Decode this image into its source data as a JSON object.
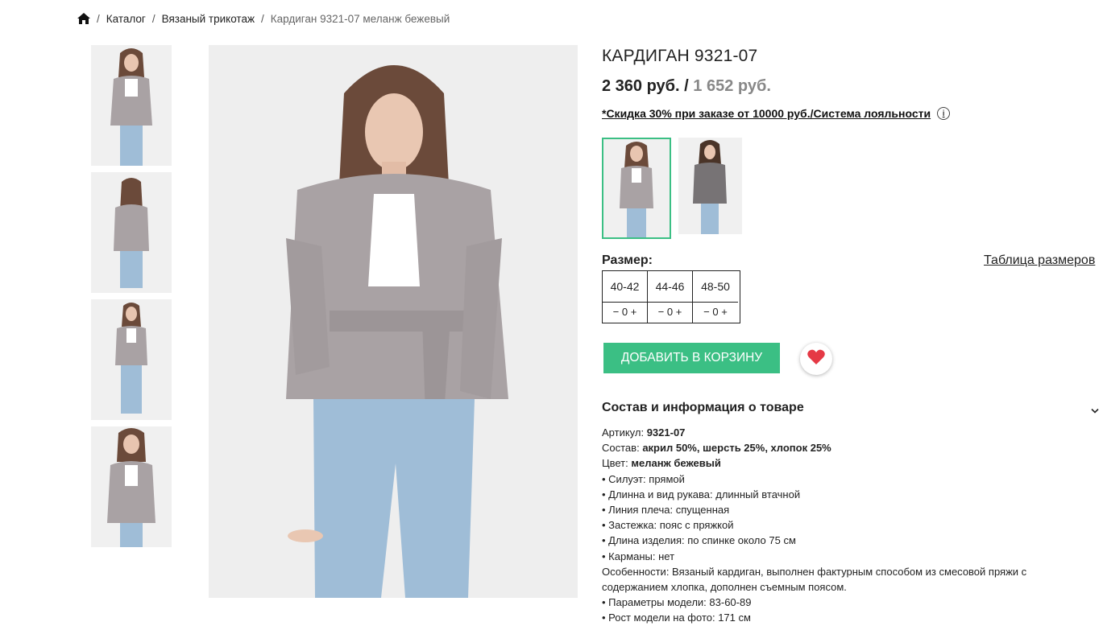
{
  "breadcrumb": {
    "home_icon": "home-icon",
    "items": [
      "Каталог",
      "Вязаный трикотаж"
    ],
    "current": "Кардиган 9321-07 меланж бежевый",
    "separator": "/"
  },
  "product": {
    "title": "КАРДИГАН 9321-07",
    "price": "2 360 руб.",
    "price_separator": "/",
    "sale_price": "1 652 руб.",
    "discount_text": "*Скидка 30% при заказе от 10000 руб./Система лояльности",
    "info_icon": "info-icon"
  },
  "sizes": {
    "label": "Размер:",
    "table_link": "Таблица размеров",
    "items": [
      {
        "name": "40-42",
        "qty": "− 0 +"
      },
      {
        "name": "44-46",
        "qty": "− 0 +"
      },
      {
        "name": "48-50",
        "qty": "− 0 +"
      }
    ]
  },
  "actions": {
    "add_to_cart": "ДОБАВИТЬ В КОРЗИНУ",
    "favorite_icon": "heart-icon"
  },
  "details": {
    "title": "Состав и информация о товаре",
    "article_label": "Артикул:",
    "article_value": "9321-07",
    "composition_label": "Состав:",
    "composition_value": "акрил 50%, шерсть 25%, хлопок 25%",
    "color_label": "Цвет:",
    "color_value": "меланж бежевый",
    "lines": [
      "• Силуэт: прямой",
      "• Длинна и вид рукава: длинный втачной",
      "• Линия плеча: спущенная",
      "• Застежка: пояс с пряжкой",
      "• Длина изделия: по спинке около 75 см",
      "• Карманы: нет",
      "Особенности: Вязаный кардиган, выполнен фактурным способом из смесовой пряжи с",
      "содержанием хлопка, дополнен съемным поясом.",
      "• Параметры модели: 83-60-89",
      "• Рост модели на фото: 171 см"
    ]
  },
  "colors": {
    "accent": "#3bbf84",
    "heart": "#e53945",
    "sweater": "#a9a2a4",
    "jeans": "#9fbdd7"
  }
}
